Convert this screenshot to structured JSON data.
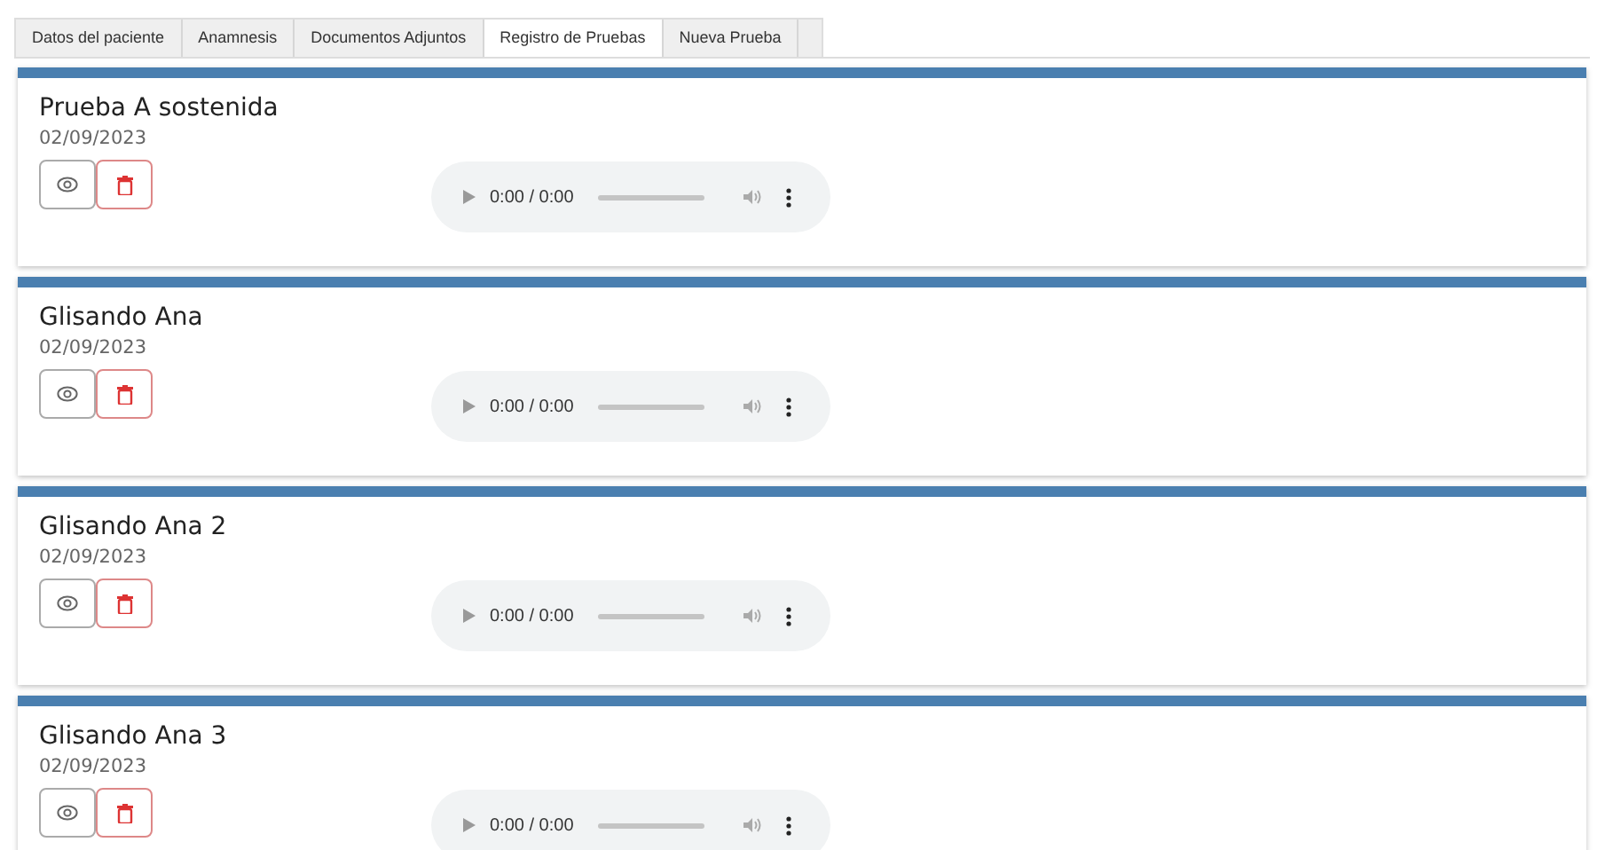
{
  "tabs": [
    {
      "label": "Datos del paciente",
      "selected": false
    },
    {
      "label": "Anamnesis",
      "selected": false
    },
    {
      "label": "Documentos Adjuntos",
      "selected": false
    },
    {
      "label": "Registro de Pruebas",
      "selected": true
    },
    {
      "label": "Nueva Prueba",
      "selected": false
    }
  ],
  "tests": [
    {
      "title": "Prueba A sostenida",
      "date": "02/09/2023",
      "time": "0:00 / 0:00"
    },
    {
      "title": "Glisando Ana",
      "date": "02/09/2023",
      "time": "0:00 / 0:00"
    },
    {
      "title": "Glisando Ana 2",
      "date": "02/09/2023",
      "time": "0:00 / 0:00"
    },
    {
      "title": "Glisando Ana 3",
      "date": "02/09/2023",
      "time": "0:00 / 0:00"
    }
  ]
}
